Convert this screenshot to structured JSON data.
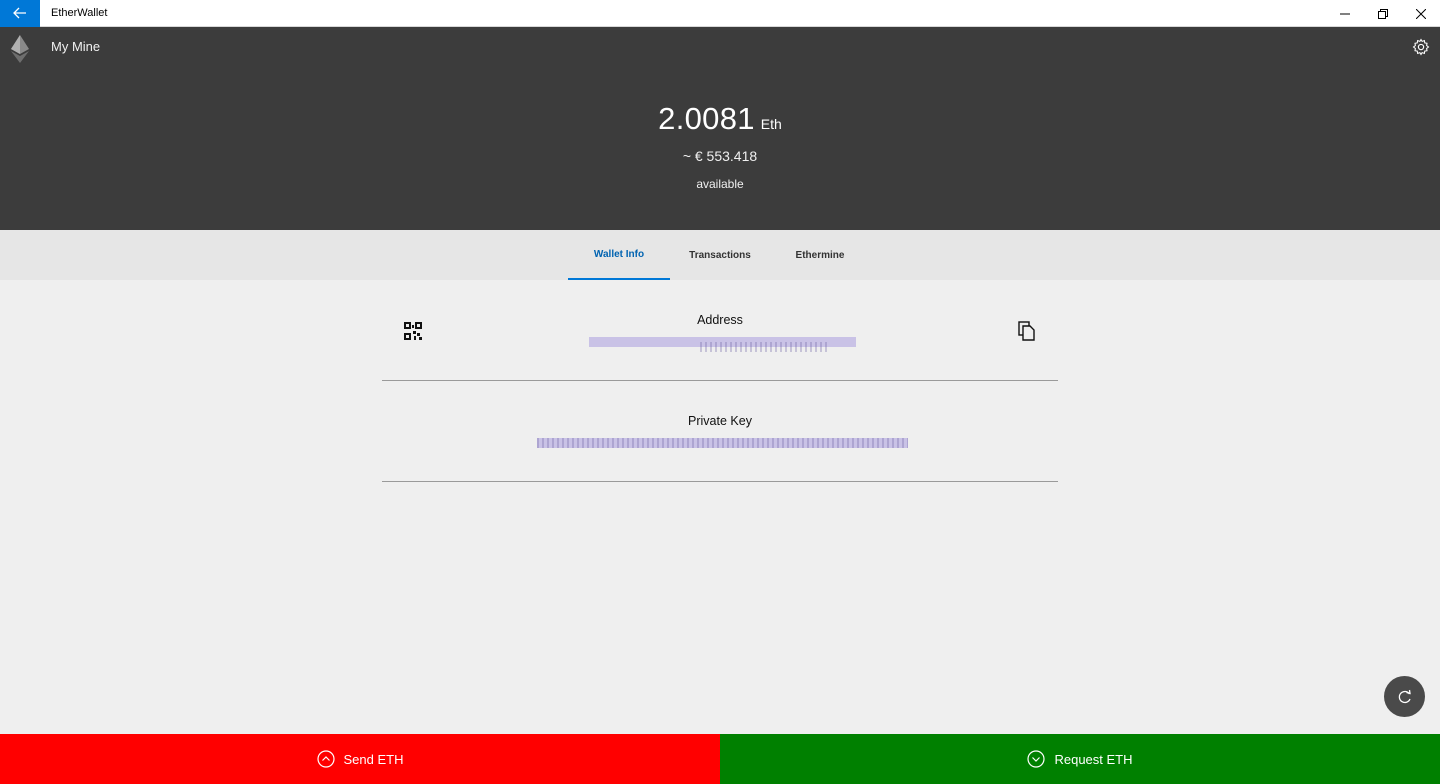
{
  "window": {
    "title": "EtherWallet",
    "controls": [
      "minimize-icon",
      "restore-icon",
      "close-icon"
    ],
    "accent_color": "#0078d7"
  },
  "header": {
    "wallet_name": "My Mine",
    "balance_amount": "2.0081",
    "balance_unit": "Eth",
    "fiat_value": "~ € 553.418",
    "status": "available",
    "logo_icon": "ethereum-icon",
    "settings_icon": "gear-icon",
    "background": "#3c3c3c"
  },
  "tabs": [
    {
      "label": "Wallet Info",
      "active": true
    },
    {
      "label": "Transactions",
      "active": false
    },
    {
      "label": "Ethermine",
      "active": false
    }
  ],
  "wallet_info": {
    "address_label": "Address",
    "private_key_label": "Private Key",
    "qr_icon": "qr-code-icon",
    "copy_icon": "copy-icon"
  },
  "actions": {
    "send_label": "Send ETH",
    "send_color": "#ff0000",
    "request_label": "Request ETH",
    "request_color": "#008000",
    "refresh_icon": "refresh-icon"
  }
}
